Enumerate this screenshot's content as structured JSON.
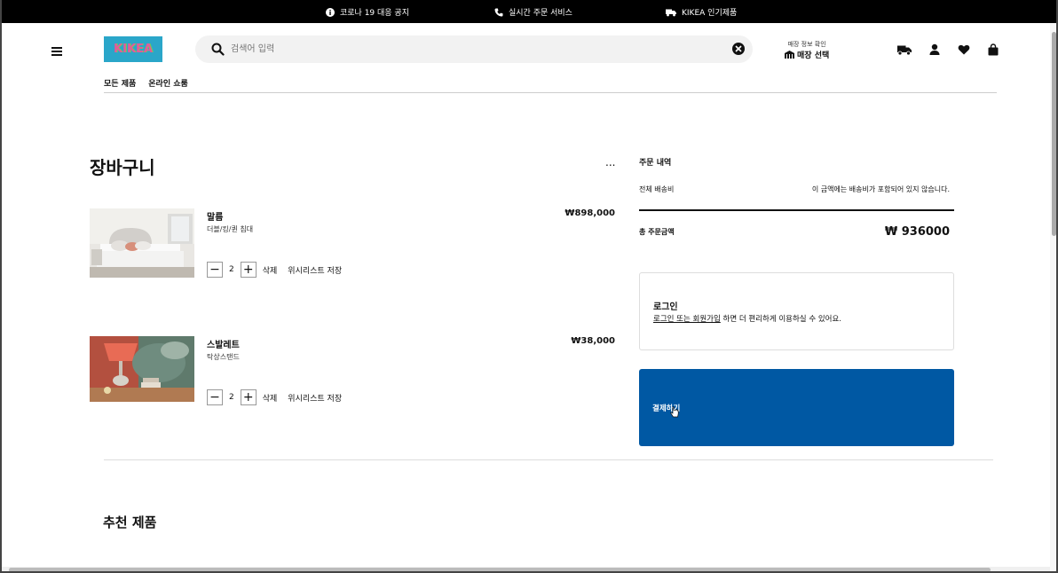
{
  "topbar": {
    "notice": "코로나 19 대응 공지",
    "service": "실시간 주문 서비스",
    "popular": "KIKEA 인기제품"
  },
  "header": {
    "logo_text": "KIKEA",
    "search": {
      "placeholder": "검색어 입력",
      "value": ""
    },
    "store": {
      "small": "매장 정보 확인",
      "big": "매장 선택"
    },
    "icons": [
      "truck-icon",
      "user-icon",
      "heart-icon",
      "bag-icon"
    ]
  },
  "nav": {
    "items": [
      "모든 제품",
      "온라인 쇼룸"
    ]
  },
  "cart": {
    "title": "장바구니",
    "more": "...",
    "items": [
      {
        "name": "말름",
        "desc": "더블/킹/퀸 침대",
        "price": "₩898,000",
        "qty": "2",
        "delete": "삭제",
        "wishlist": "위시리스트 저장"
      },
      {
        "name": "스발레트",
        "desc": "탁상스탠드",
        "price": "₩38,000",
        "qty": "2",
        "delete": "삭제",
        "wishlist": "위시리스트 저장"
      }
    ]
  },
  "summary": {
    "title": "주문 내역",
    "ship_label": "전체 배송비",
    "ship_note": "이 금액에는 배송비가 포함되어 있지 않습니다.",
    "total_label": "총 주문금액",
    "total_value": "₩ 936000"
  },
  "login": {
    "title": "로그인",
    "link": "로그인 또는 회원가입",
    "rest": " 하면 더 편리하게 이용하실 수 있어요."
  },
  "checkout": {
    "label": "결제하기"
  },
  "recommend": {
    "title": "추천 제품"
  },
  "colors": {
    "checkout": "#0058a3",
    "topbar": "#000000",
    "logo_bg": "#2aa6c9"
  }
}
